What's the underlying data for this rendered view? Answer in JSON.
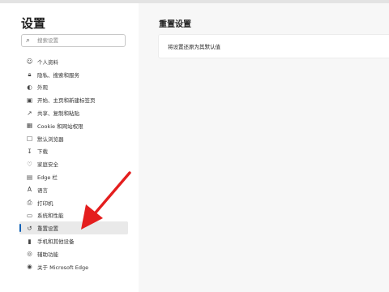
{
  "sidebar": {
    "title": "设置",
    "search": {
      "placeholder": "搜索设置",
      "value": ""
    },
    "items": [
      {
        "label": "个人资料",
        "icon": "profile-icon"
      },
      {
        "label": "隐私、搜索和服务",
        "icon": "privacy-lock-icon"
      },
      {
        "label": "外观",
        "icon": "appearance-icon"
      },
      {
        "label": "开始、主页和新建标签页",
        "icon": "start-home-icon"
      },
      {
        "label": "共享、复制和粘贴",
        "icon": "share-icon"
      },
      {
        "label": "Cookie 和网站权限",
        "icon": "cookie-icon"
      },
      {
        "label": "默认浏览器",
        "icon": "default-browser-icon"
      },
      {
        "label": "下载",
        "icon": "download-icon"
      },
      {
        "label": "家庭安全",
        "icon": "family-icon"
      },
      {
        "label": "Edge 栏",
        "icon": "edge-bar-icon"
      },
      {
        "label": "语言",
        "icon": "language-icon"
      },
      {
        "label": "打印机",
        "icon": "printer-icon"
      },
      {
        "label": "系统和性能",
        "icon": "system-icon"
      },
      {
        "label": "重置设置",
        "icon": "reset-icon",
        "selected": true
      },
      {
        "label": "手机和其他设备",
        "icon": "phone-icon"
      },
      {
        "label": "辅助功能",
        "icon": "accessibility-icon"
      },
      {
        "label": "关于 Microsoft Edge",
        "icon": "edge-logo-icon"
      }
    ]
  },
  "main": {
    "title": "重置设置",
    "option": "将设置还原为其默认值"
  },
  "colors": {
    "accent": "#0a5fb4",
    "arrow": "#e41e1e",
    "selected_bg": "#e9e9e9",
    "page_bg": "#f7f7f7"
  }
}
